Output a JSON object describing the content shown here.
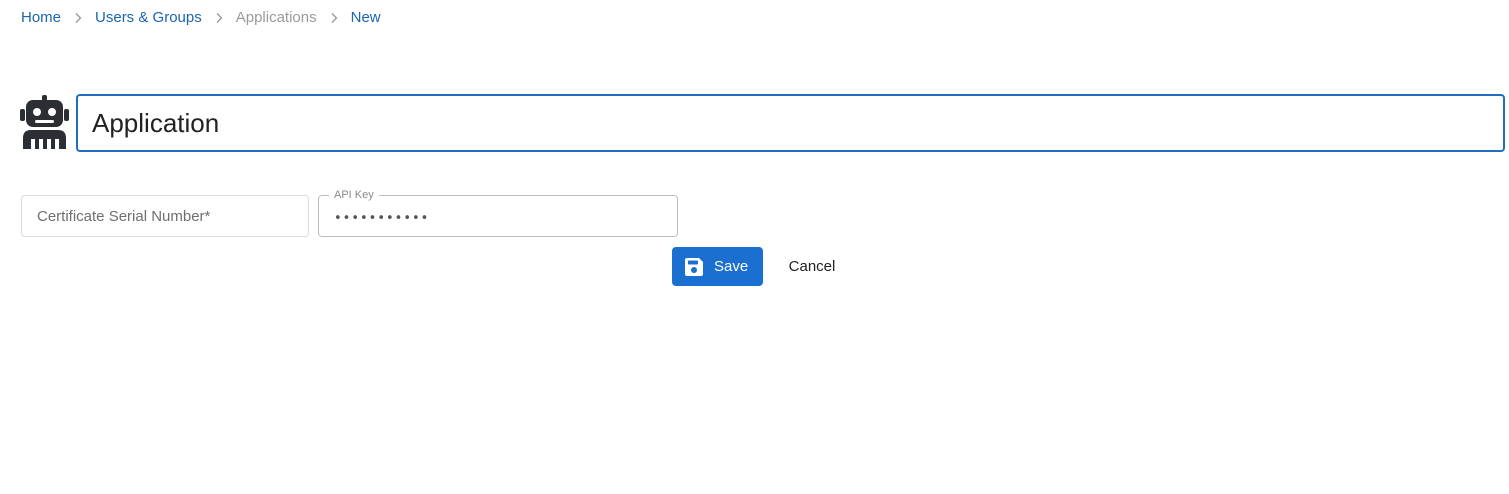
{
  "breadcrumb": {
    "items": [
      {
        "label": "Home",
        "state": "link"
      },
      {
        "label": "Users & Groups",
        "state": "link"
      },
      {
        "label": "Applications",
        "state": "muted"
      },
      {
        "label": "New",
        "state": "link"
      }
    ],
    "separator_icon": "chevron-right-icon"
  },
  "title": {
    "icon": "robot-icon",
    "value": "Application"
  },
  "fields": {
    "certificate_serial": {
      "placeholder": "Certificate Serial Number*",
      "value": ""
    },
    "api_key": {
      "label": "API Key",
      "value": "•••••••••••"
    }
  },
  "actions": {
    "save_label": "Save",
    "save_icon": "floppy-disk-icon",
    "cancel_label": "Cancel"
  },
  "colors": {
    "link": "#1a66b3",
    "muted": "#9a9a9a",
    "primary": "#1a6fd1",
    "focus_border": "#1f6ebf",
    "icon": "#2b2f33"
  }
}
